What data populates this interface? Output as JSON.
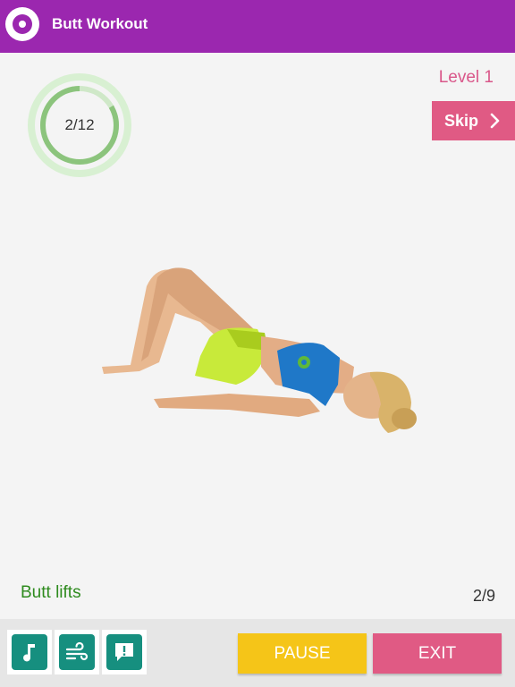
{
  "header": {
    "title": "Butt Workout",
    "icon": "app-logo-icon",
    "color": "#9b27af"
  },
  "progress": {
    "text": "2/12",
    "fraction": 0.167
  },
  "level": {
    "label": "Level 1"
  },
  "skip": {
    "label": "Skip",
    "icon": "chevron-right-icon"
  },
  "exercise": {
    "name": "Butt lifts",
    "counter": "2/9",
    "illustration": "woman-doing-glute-bridge"
  },
  "toolbar": {
    "tools": [
      {
        "icon": "music-note-icon"
      },
      {
        "icon": "wind-icon"
      },
      {
        "icon": "feedback-icon"
      }
    ]
  },
  "actions": {
    "pause_label": "PAUSE",
    "exit_label": "EXIT"
  },
  "colors": {
    "accent": "#9b27af",
    "pink": "#e05a84",
    "yellow": "#f5c518",
    "teal": "#168f7f",
    "green": "#2e8b1e"
  }
}
